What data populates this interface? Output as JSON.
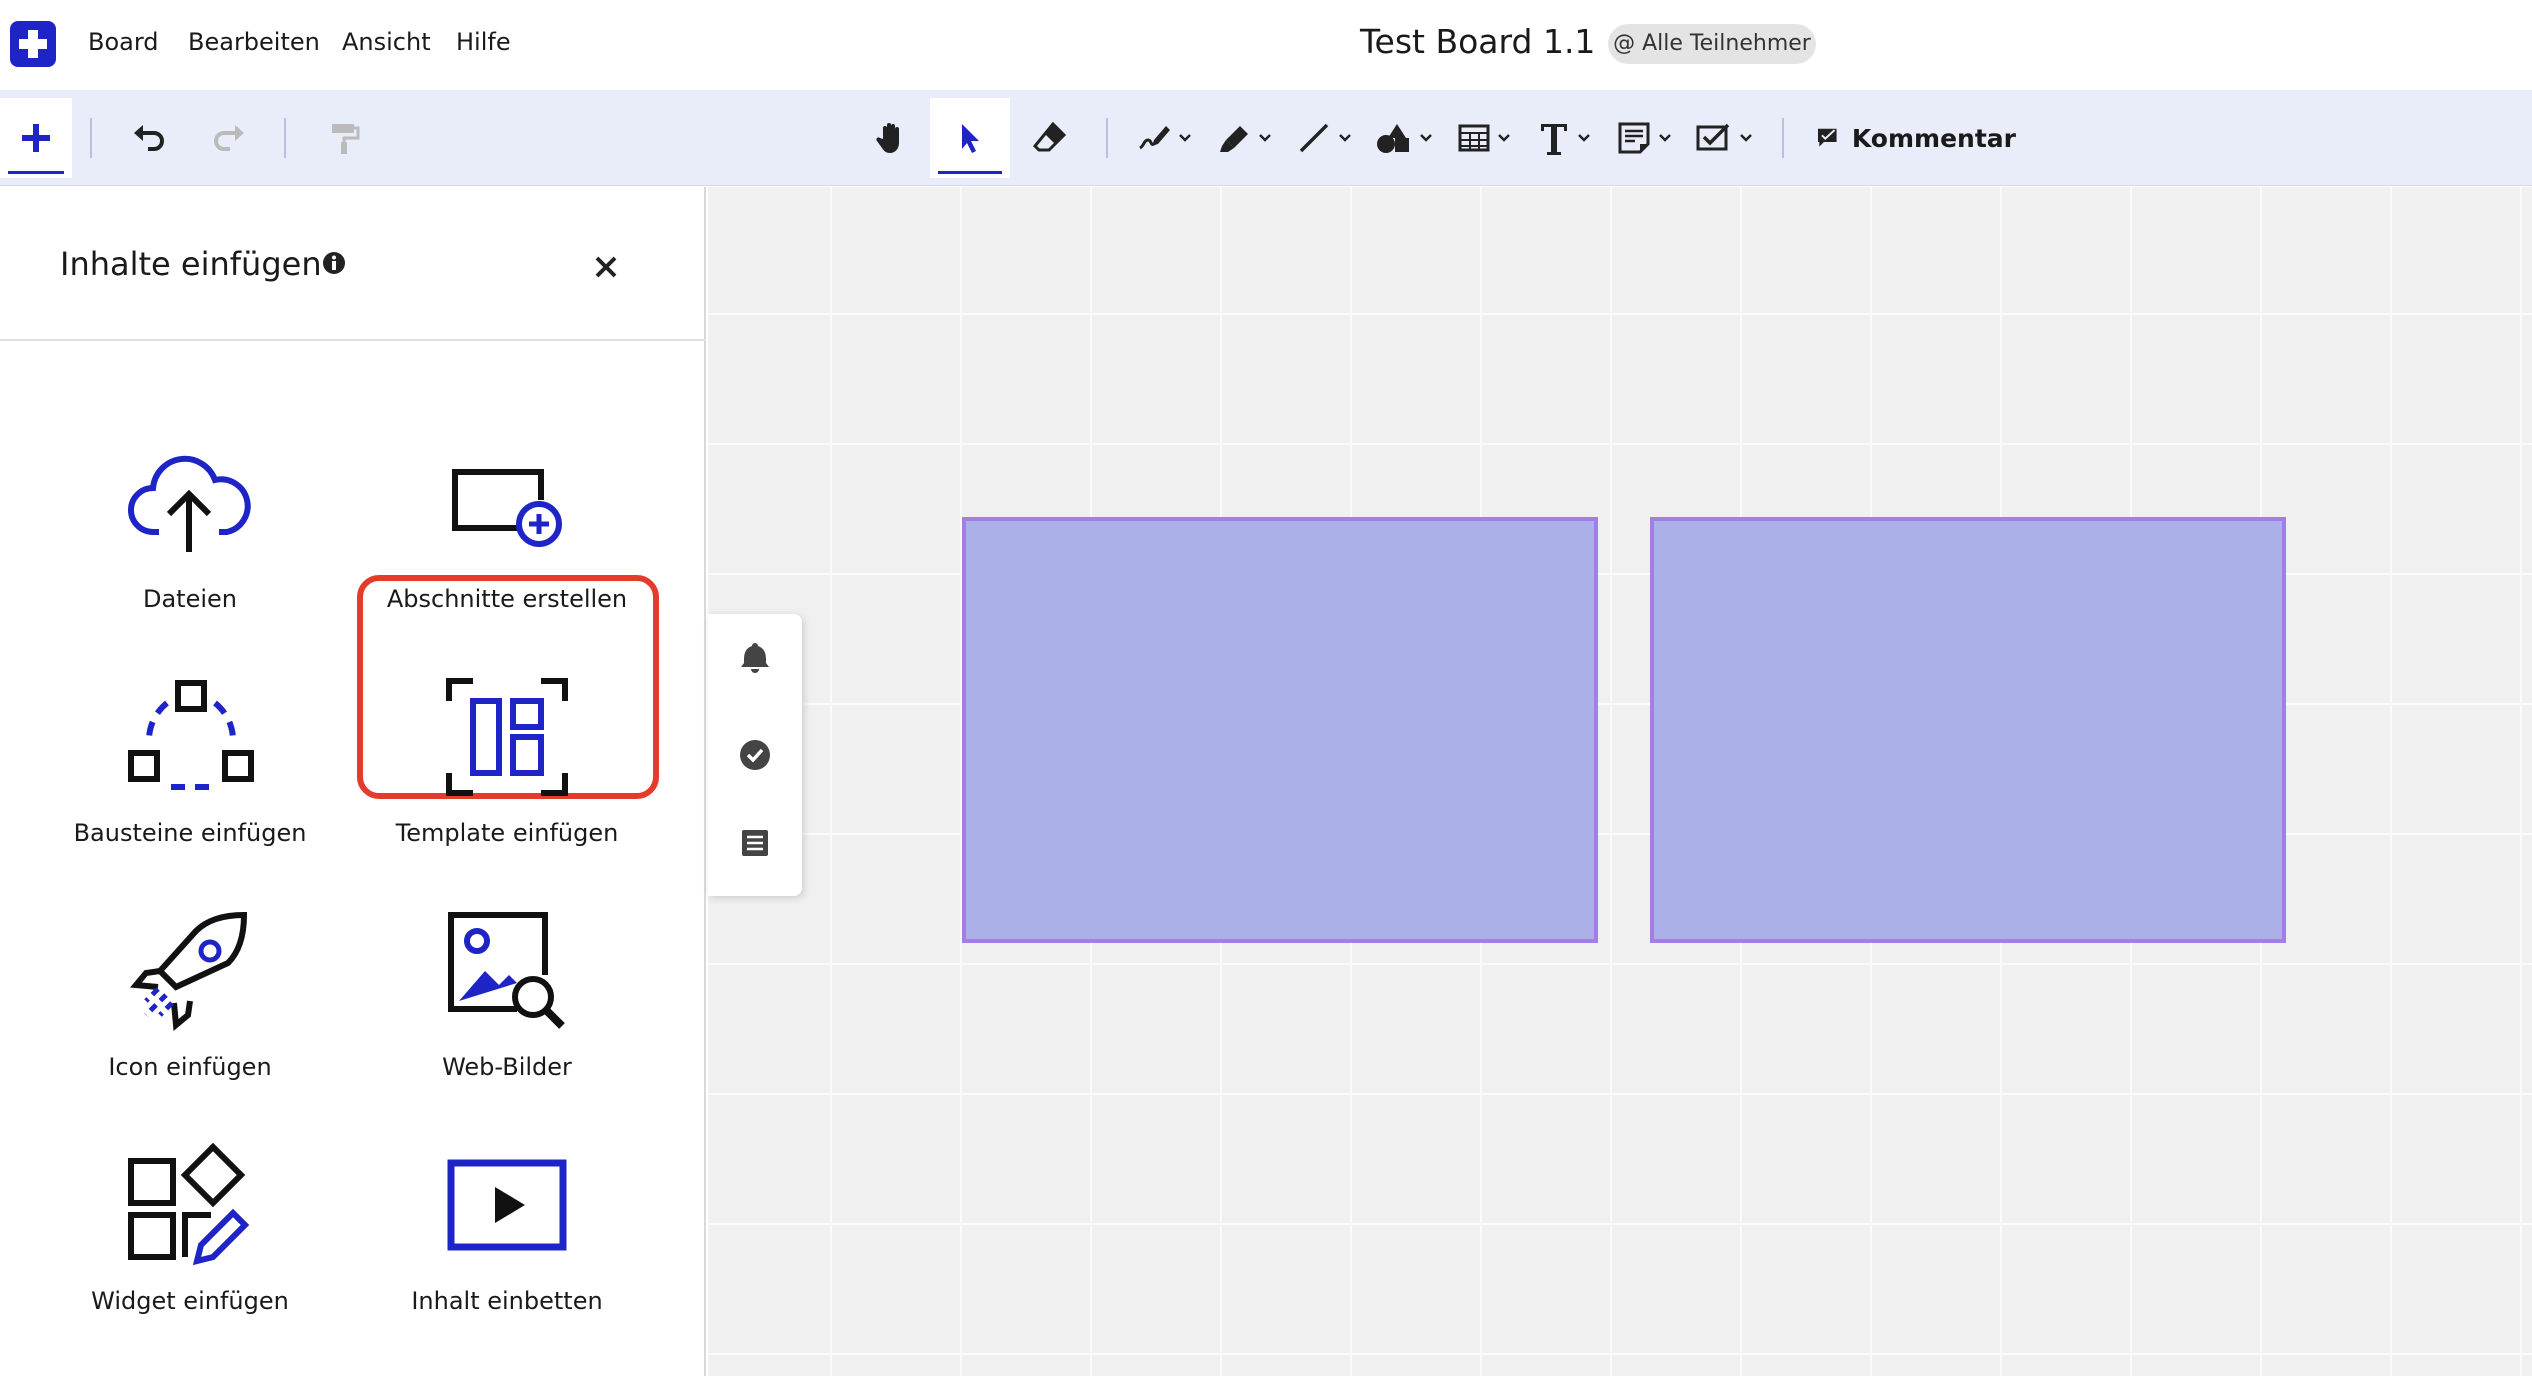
{
  "menubar": {
    "items": [
      "Board",
      "Bearbeiten",
      "Ansicht",
      "Hilfe"
    ],
    "title": "Test Board 1.1",
    "participants_badge": "@ Alle Teilnehmer"
  },
  "toolbar": {
    "comment_label": "Kommentar",
    "active_tool": "select",
    "accent_color": "#1f24c7"
  },
  "panel": {
    "title": "Inhalte einfügen",
    "tiles": [
      {
        "label": "Dateien",
        "icon": "cloud-upload-icon"
      },
      {
        "label": "Abschnitte erstellen",
        "icon": "section-add-icon",
        "highlighted": true
      },
      {
        "label": "Bausteine einfügen",
        "icon": "building-blocks-icon"
      },
      {
        "label": "Template einfügen",
        "icon": "template-icon"
      },
      {
        "label": "Icon einfügen",
        "icon": "rocket-icon"
      },
      {
        "label": "Web-Bilder",
        "icon": "image-search-icon"
      },
      {
        "label": "Widget einfügen",
        "icon": "widget-icon"
      },
      {
        "label": "Inhalt einbetten",
        "icon": "embed-play-icon"
      }
    ]
  },
  "canvas": {
    "section_fill": "#abb0e8",
    "section_border": "#a37de8",
    "highlight_color": "#e53b2c"
  }
}
